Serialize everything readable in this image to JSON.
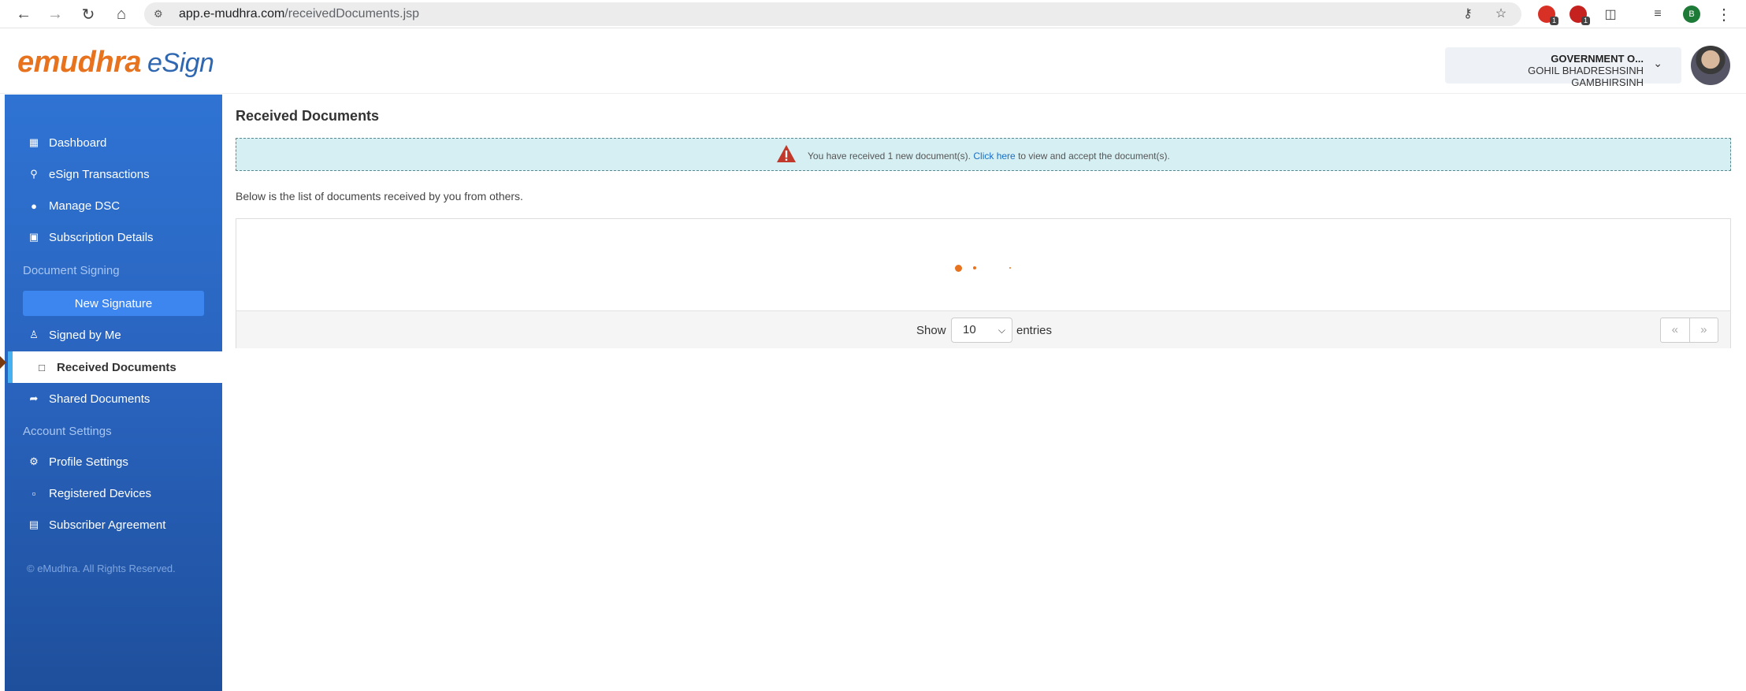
{
  "browser": {
    "url_host": "app.e-mudhra.com",
    "url_path": "/receivedDocuments.jsp",
    "profile_initial": "B",
    "ext_badges": [
      "1",
      "1"
    ]
  },
  "header": {
    "logo_brand": "emudhra",
    "logo_product": "eSign",
    "user_org": "GOVERNMENT O...",
    "user_name": "GOHIL BHADRESHSINH GAMBHIRSINH"
  },
  "sidebar": {
    "items": [
      {
        "label": "Dashboard",
        "icon": "dashboard-icon"
      },
      {
        "label": "eSign Transactions",
        "icon": "search-icon"
      },
      {
        "label": "Manage DSC",
        "icon": "circle-icon"
      },
      {
        "label": "Subscription Details",
        "icon": "money-icon"
      }
    ],
    "section_document_signing": "Document Signing",
    "new_signature": "New Signature",
    "doc_items": [
      {
        "label": "Signed by Me",
        "icon": "user-icon"
      },
      {
        "label": "Received Documents",
        "icon": "file-icon"
      },
      {
        "label": "Shared Documents",
        "icon": "share-icon"
      }
    ],
    "section_account_settings": "Account Settings",
    "account_items": [
      {
        "label": "Profile Settings",
        "icon": "cogs-icon"
      },
      {
        "label": "Registered Devices",
        "icon": "device-icon"
      },
      {
        "label": "Subscriber Agreement",
        "icon": "pdf-icon"
      }
    ],
    "copyright": "© eMudhra. All Rights Reserved."
  },
  "main": {
    "title": "Received Documents",
    "alert_pre": "You have received 1 new document(s).",
    "alert_link": "Click here",
    "alert_post": "to view and accept the document(s).",
    "subtext": "Below is the list of documents received by you from others.",
    "show_label": "Show",
    "entries_value": "10",
    "entries_label": "entries",
    "pager_prev": "«",
    "pager_next": "»"
  },
  "colors": {
    "sidebar_top": "#2f73d3",
    "sidebar_bottom": "#1e4f9c",
    "brand_orange": "#e8731f",
    "alert_bg": "#d6eff3"
  }
}
